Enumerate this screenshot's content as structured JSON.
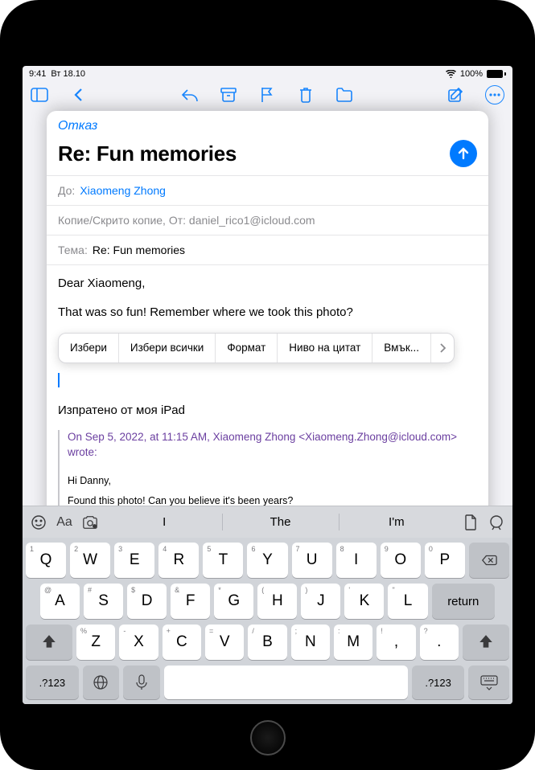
{
  "status": {
    "time": "9:41",
    "date": "Вт 18.10",
    "battery": "100%"
  },
  "compose": {
    "cancel": "Отказ",
    "subjectTitle": "Re: Fun memories",
    "toLabel": "До:",
    "toValue": "Xiaomeng Zhong",
    "ccLine": "Копие/Скрито копие, От: daniel_rico1@icloud.com",
    "subjectLabel": "Тема:",
    "subjectValue": "Re: Fun memories",
    "bodyGreeting": "Dear Xiaomeng,",
    "bodyLine": "That was so fun! Remember where we took this photo?",
    "signature": "Изпратено от моя iPad",
    "quoteHeader": "On Sep 5, 2022, at 11:15 AM, Xiaomeng Zhong <Xiaomeng.Zhong@icloud.com> wrote:",
    "quoteBody1": "Hi Danny,",
    "quoteBody2": "Found this photo! Can you believe it's been years?"
  },
  "contextMenu": {
    "select": "Избери",
    "selectAll": "Избери всички",
    "format": "Формат",
    "quoteLevel": "Ниво на цитат",
    "insert": "Вмък..."
  },
  "predictions": {
    "w1": "I",
    "w2": "The",
    "w3": "I'm"
  },
  "keyboard": {
    "row1": [
      {
        "m": "Q",
        "a": "1"
      },
      {
        "m": "W",
        "a": "2"
      },
      {
        "m": "E",
        "a": "3"
      },
      {
        "m": "R",
        "a": "4"
      },
      {
        "m": "T",
        "a": "5"
      },
      {
        "m": "Y",
        "a": "6"
      },
      {
        "m": "U",
        "a": "7"
      },
      {
        "m": "I",
        "a": "8"
      },
      {
        "m": "O",
        "a": "9"
      },
      {
        "m": "P",
        "a": "0"
      }
    ],
    "row2": [
      {
        "m": "A",
        "a": "@"
      },
      {
        "m": "S",
        "a": "#"
      },
      {
        "m": "D",
        "a": "$"
      },
      {
        "m": "F",
        "a": "&"
      },
      {
        "m": "G",
        "a": "*"
      },
      {
        "m": "H",
        "a": "("
      },
      {
        "m": "J",
        "a": ")"
      },
      {
        "m": "K",
        "a": "'"
      },
      {
        "m": "L",
        "a": "\""
      }
    ],
    "row3": [
      {
        "m": "Z",
        "a": "%"
      },
      {
        "m": "X",
        "a": "-"
      },
      {
        "m": "C",
        "a": "+"
      },
      {
        "m": "V",
        "a": "="
      },
      {
        "m": "B",
        "a": "/"
      },
      {
        "m": "N",
        "a": ";"
      },
      {
        "m": "M",
        "a": ":"
      }
    ],
    "comma": {
      "m": ",",
      "a": "!"
    },
    "period": {
      "m": ".",
      "a": "?"
    },
    "numKey": ".?123",
    "returnKey": "return"
  }
}
